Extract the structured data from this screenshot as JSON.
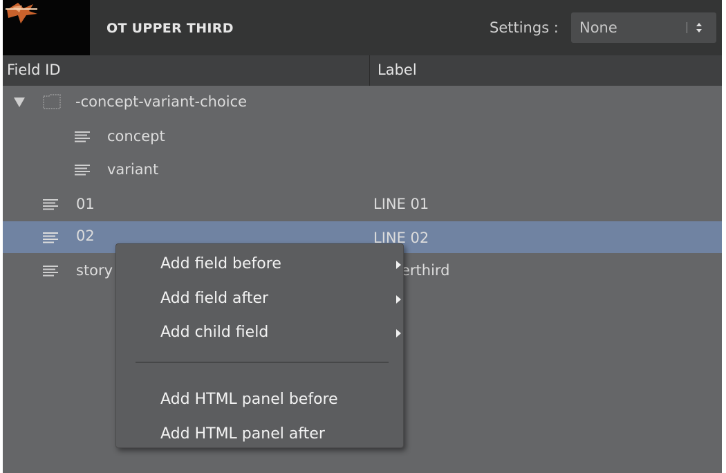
{
  "header": {
    "title": "OT UPPER THIRD",
    "settings_label": "Settings :",
    "settings_value": "None"
  },
  "columns": {
    "field_id": "Field ID",
    "label": "Label"
  },
  "rows": [
    {
      "id": "-concept-variant-choice",
      "label": "",
      "icon": "folder-icon",
      "expanded": true
    },
    {
      "id": "concept",
      "label": "",
      "icon": "text-lines-icon"
    },
    {
      "id": "variant",
      "label": "",
      "icon": "text-lines-icon"
    },
    {
      "id": "01",
      "label": "LINE 01",
      "icon": "text-lines-icon"
    },
    {
      "id": "02",
      "label": "LINE 02",
      "icon": "text-lines-icon",
      "selected": true
    },
    {
      "id": "story",
      "label": "upperthird",
      "icon": "text-lines-icon"
    }
  ],
  "context_menu": {
    "items": [
      "Add field before",
      "Add field after",
      "Add child field",
      "Add HTML panel before",
      "Add HTML panel after"
    ]
  },
  "colors": {
    "panel_bg": "#656668",
    "header_bg": "#343535",
    "selected_row": "#7083a2",
    "menu_bg": "#5c5d5f"
  }
}
